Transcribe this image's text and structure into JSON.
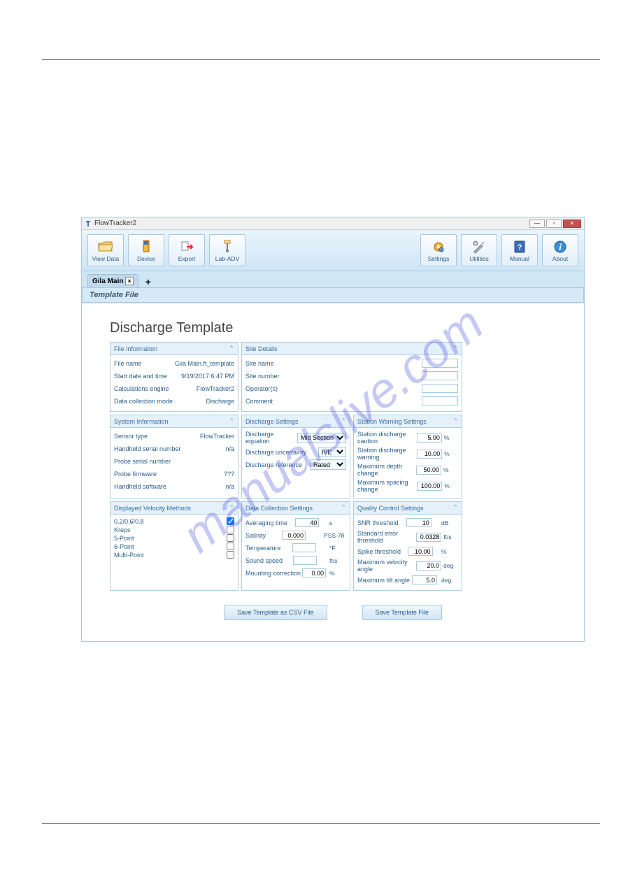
{
  "watermark": "manualslive.com",
  "window": {
    "title": "FlowTracker2"
  },
  "toolbar": {
    "view_data": "View Data",
    "device": "Device",
    "export": "Export",
    "lab_adv": "Lab-ADV",
    "settings": "Settings",
    "utilities": "Utilities",
    "manual": "Manual",
    "about": "About"
  },
  "tabs": {
    "active": "Gila Main",
    "add": "+"
  },
  "subheader": "Template File",
  "heading": "Discharge Template",
  "panels": {
    "file_info": {
      "title": "File Information",
      "file_name_l": "File name",
      "file_name_v": "Gila Main.ft_template",
      "start_l": "Start date and time",
      "start_v": "9/19/2017 6:47 PM",
      "calc_l": "Calculations engine",
      "calc_v": "FlowTracker2",
      "mode_l": "Data collection mode",
      "mode_v": "Discharge"
    },
    "site": {
      "title": "Site Details",
      "site_name_l": "Site name",
      "site_name_v": "",
      "site_num_l": "Site number",
      "site_num_v": "",
      "operator_l": "Operator(s)",
      "operator_v": "",
      "comment_l": "Comment",
      "comment_v": ""
    },
    "sys": {
      "title": "System Information",
      "sensor_l": "Sensor type",
      "sensor_v": "FlowTracker",
      "hhsn_l": "Handheld serial number",
      "hhsn_v": "n/a",
      "probe_l": "Probe serial number",
      "probe_v": "",
      "pfw_l": "Probe firmware",
      "pfw_v": "???",
      "hhsw_l": "Handheld software",
      "hhsw_v": "n/a"
    },
    "disch": {
      "title": "Discharge Settings",
      "eq_l": "Discharge equation",
      "eq_v": "Mid Section",
      "unc_l": "Discharge uncertainty",
      "unc_v": "IVE",
      "ref_l": "Discharge reference",
      "ref_v": "Rated"
    },
    "warn": {
      "title": "Station Warning Settings",
      "caution_l": "Station discharge caution",
      "caution_v": "5.00",
      "caution_u": "%",
      "warning_l": "Station discharge warning",
      "warning_v": "10.00",
      "warning_u": "%",
      "depth_l": "Maximum depth change",
      "depth_v": "50.00",
      "depth_u": "%",
      "spacing_l": "Maximum spacing change",
      "spacing_v": "100.00",
      "spacing_u": "%"
    },
    "vel": {
      "title": "Displayed Velocity Methods",
      "m0": "0.2/0.6/0.8",
      "m1": "Kreps",
      "m2": "5-Point",
      "m3": "6-Point",
      "m4": "Multi-Point"
    },
    "dcs": {
      "title": "Data Collection Settings",
      "avg_l": "Averaging time",
      "avg_v": "40",
      "avg_u": "s",
      "sal_l": "Salinity",
      "sal_v": "0.000",
      "sal_u": "PSS-78",
      "temp_l": "Temperature",
      "temp_v": "",
      "temp_u": "°F",
      "ss_l": "Sound speed",
      "ss_v": "",
      "ss_u": "ft/s",
      "mc_l": "Mounting correction",
      "mc_v": "0.00",
      "mc_u": "%"
    },
    "qc": {
      "title": "Quality Control Settings",
      "snr_l": "SNR threshold",
      "snr_v": "10",
      "snr_u": "dB",
      "se_l": "Standard error threshold",
      "se_v": "0.0328",
      "se_u": "ft/s",
      "spike_l": "Spike threshold",
      "spike_v": "10.00",
      "spike_u": "%",
      "va_l": "Maximum velocity angle",
      "va_v": "20.0",
      "va_u": "deg",
      "tilt_l": "Maximum tilt angle",
      "tilt_v": "5.0",
      "tilt_u": "deg"
    }
  },
  "buttons": {
    "csv": "Save Template as CSV File",
    "save": "Save Template File"
  }
}
